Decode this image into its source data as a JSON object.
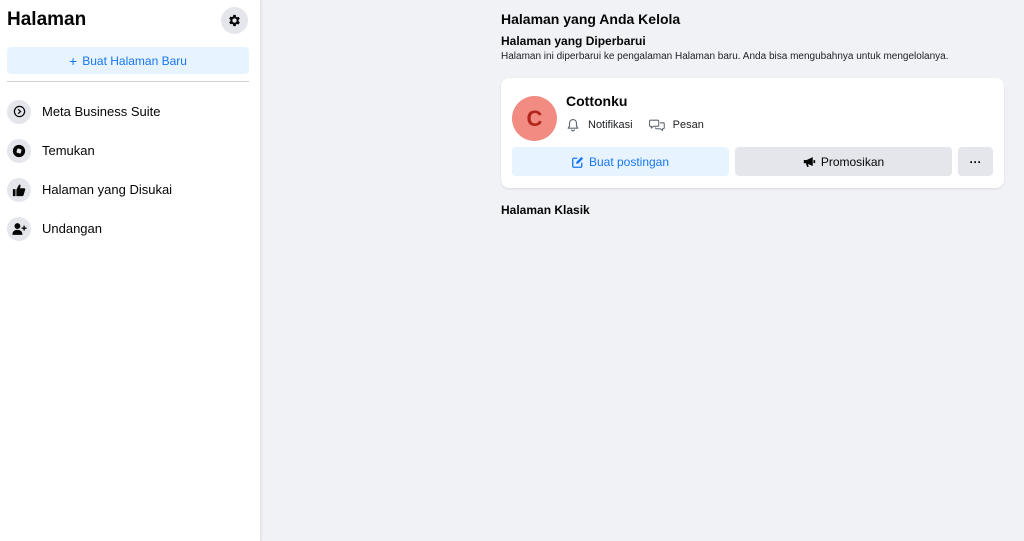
{
  "sidebar": {
    "title": "Halaman",
    "settings_icon": "gear-icon",
    "create_button": {
      "icon": "plus-icon",
      "label": "Buat Halaman Baru"
    },
    "items": [
      {
        "icon": "meta-business-icon",
        "label": "Meta Business Suite"
      },
      {
        "icon": "compass-icon",
        "label": "Temukan"
      },
      {
        "icon": "thumbs-up-icon",
        "label": "Halaman yang Disukai"
      },
      {
        "icon": "person-add-icon",
        "label": "Undangan"
      }
    ]
  },
  "main": {
    "title": "Halaman yang Anda Kelola",
    "updated_heading": "Halaman yang Diperbarui",
    "updated_description": "Halaman ini diperbarui ke pengalaman Halaman baru. Anda bisa mengubahnya untuk mengelolanya.",
    "page_card": {
      "avatar_letter": "C",
      "name": "Cottonku",
      "notifications_label": "Notifikasi",
      "messages_label": "Pesan",
      "create_post_label": "Buat postingan",
      "promote_label": "Promosikan",
      "more_label": "···"
    },
    "classic_heading": "Halaman Klasik"
  },
  "colors": {
    "accent": "#1877f2",
    "accent_bg": "#e7f3ff",
    "page_bg": "#f0f2f5",
    "avatar_bg": "#f28b82",
    "avatar_text": "#b3261e"
  }
}
